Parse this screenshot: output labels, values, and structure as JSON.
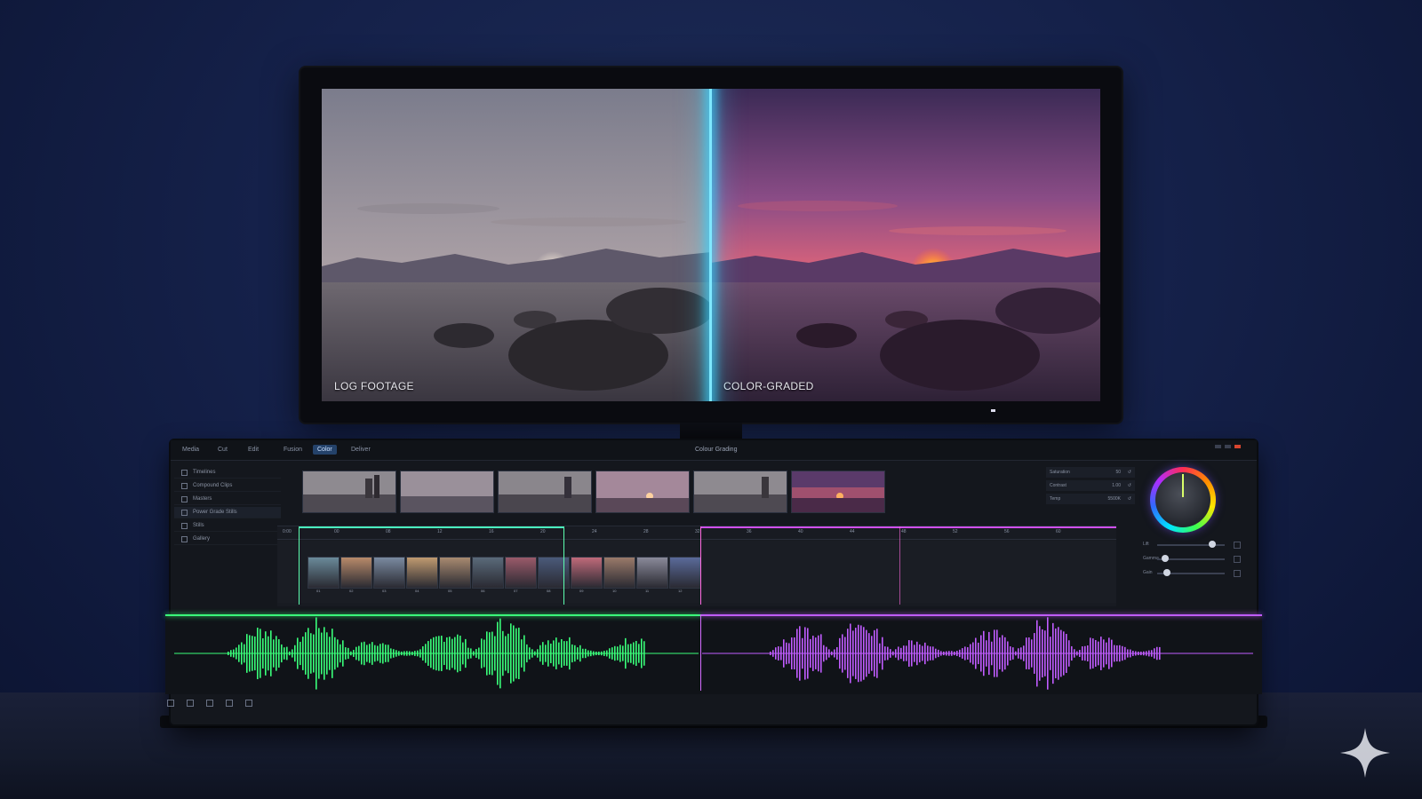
{
  "monitor": {
    "left_label": "LOG FOOTAGE",
    "right_label": "COLOR-GRADED"
  },
  "console": {
    "title": "Colour Grading",
    "menu": [
      "Media",
      "Cut",
      "Edit",
      "Fusion",
      "Color",
      "Deliver"
    ],
    "active_menu": "Color",
    "sidebar": [
      "Timelines",
      "Compound Clips",
      "Masters",
      "Power Grade Stills",
      "Stills",
      "Gallery"
    ],
    "right_panel": [
      {
        "label": "Saturation",
        "value": "50"
      },
      {
        "label": "Contrast",
        "value": "1.00"
      },
      {
        "label": "Temp",
        "value": "5500K"
      }
    ],
    "sliders": [
      "Lift",
      "Gamma",
      "Gain"
    ],
    "slider_values": [
      0.82,
      0.12,
      0.15
    ],
    "ruler_ticks": [
      "0:00",
      "00",
      "08",
      "12",
      "16",
      "20",
      "24",
      "28",
      "32",
      "36",
      "40",
      "44",
      "48",
      "52",
      "56",
      "60"
    ],
    "clip_labels": [
      "01",
      "02",
      "03",
      "04",
      "05",
      "06",
      "07",
      "08",
      "09",
      "10",
      "11",
      "12"
    ]
  },
  "accent_colors": {
    "split_line": "#38d6ff",
    "waveform_left": "#3aff7a",
    "waveform_right": "#c05cff"
  }
}
